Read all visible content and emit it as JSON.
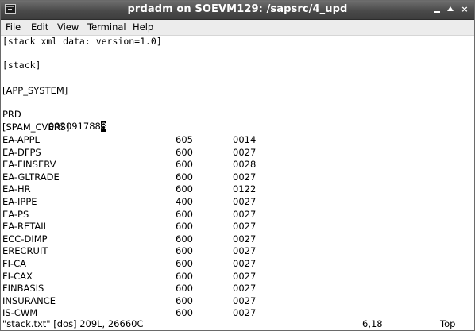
{
  "window": {
    "title": "prdadm on SOEVM129: /sapsrc/4_upd",
    "close_glyph": "×"
  },
  "menu": [
    "File",
    "Edit",
    "View",
    "Terminal",
    "Help"
  ],
  "editor": {
    "header_line": "[stack xml data: version=1.0]",
    "stack_line": "[stack]",
    "app_system_header": "[APP_SYSTEM]",
    "app_system_sid": "PRD",
    "app_system_number_before_cursor": "002091788",
    "app_system_number_cursor_char": "8",
    "spam_header": "[SPAM_CVERS]",
    "components": [
      {
        "name": "EA-APPL",
        "release": "605",
        "level": "0014"
      },
      {
        "name": "EA-DFPS",
        "release": "600",
        "level": "0027"
      },
      {
        "name": "EA-FINSERV",
        "release": "600",
        "level": "0028"
      },
      {
        "name": "EA-GLTRADE",
        "release": "600",
        "level": "0027"
      },
      {
        "name": "EA-HR",
        "release": "600",
        "level": "0122"
      },
      {
        "name": "EA-IPPE",
        "release": "400",
        "level": "0027"
      },
      {
        "name": "EA-PS",
        "release": "600",
        "level": "0027"
      },
      {
        "name": "EA-RETAIL",
        "release": "600",
        "level": "0027"
      },
      {
        "name": "ECC-DIMP",
        "release": "600",
        "level": "0027"
      },
      {
        "name": "ERECRUIT",
        "release": "600",
        "level": "0027"
      },
      {
        "name": "FI-CA",
        "release": "600",
        "level": "0027"
      },
      {
        "name": "FI-CAX",
        "release": "600",
        "level": "0027"
      },
      {
        "name": "FINBASIS",
        "release": "600",
        "level": "0027"
      },
      {
        "name": "INSURANCE",
        "release": "600",
        "level": "0027"
      },
      {
        "name": "IS-CWM",
        "release": "600",
        "level": "0027"
      }
    ]
  },
  "status": {
    "file_info": "\"stack.txt\" [dos] 209L, 26660C",
    "position": "6,18",
    "scroll": "Top"
  }
}
